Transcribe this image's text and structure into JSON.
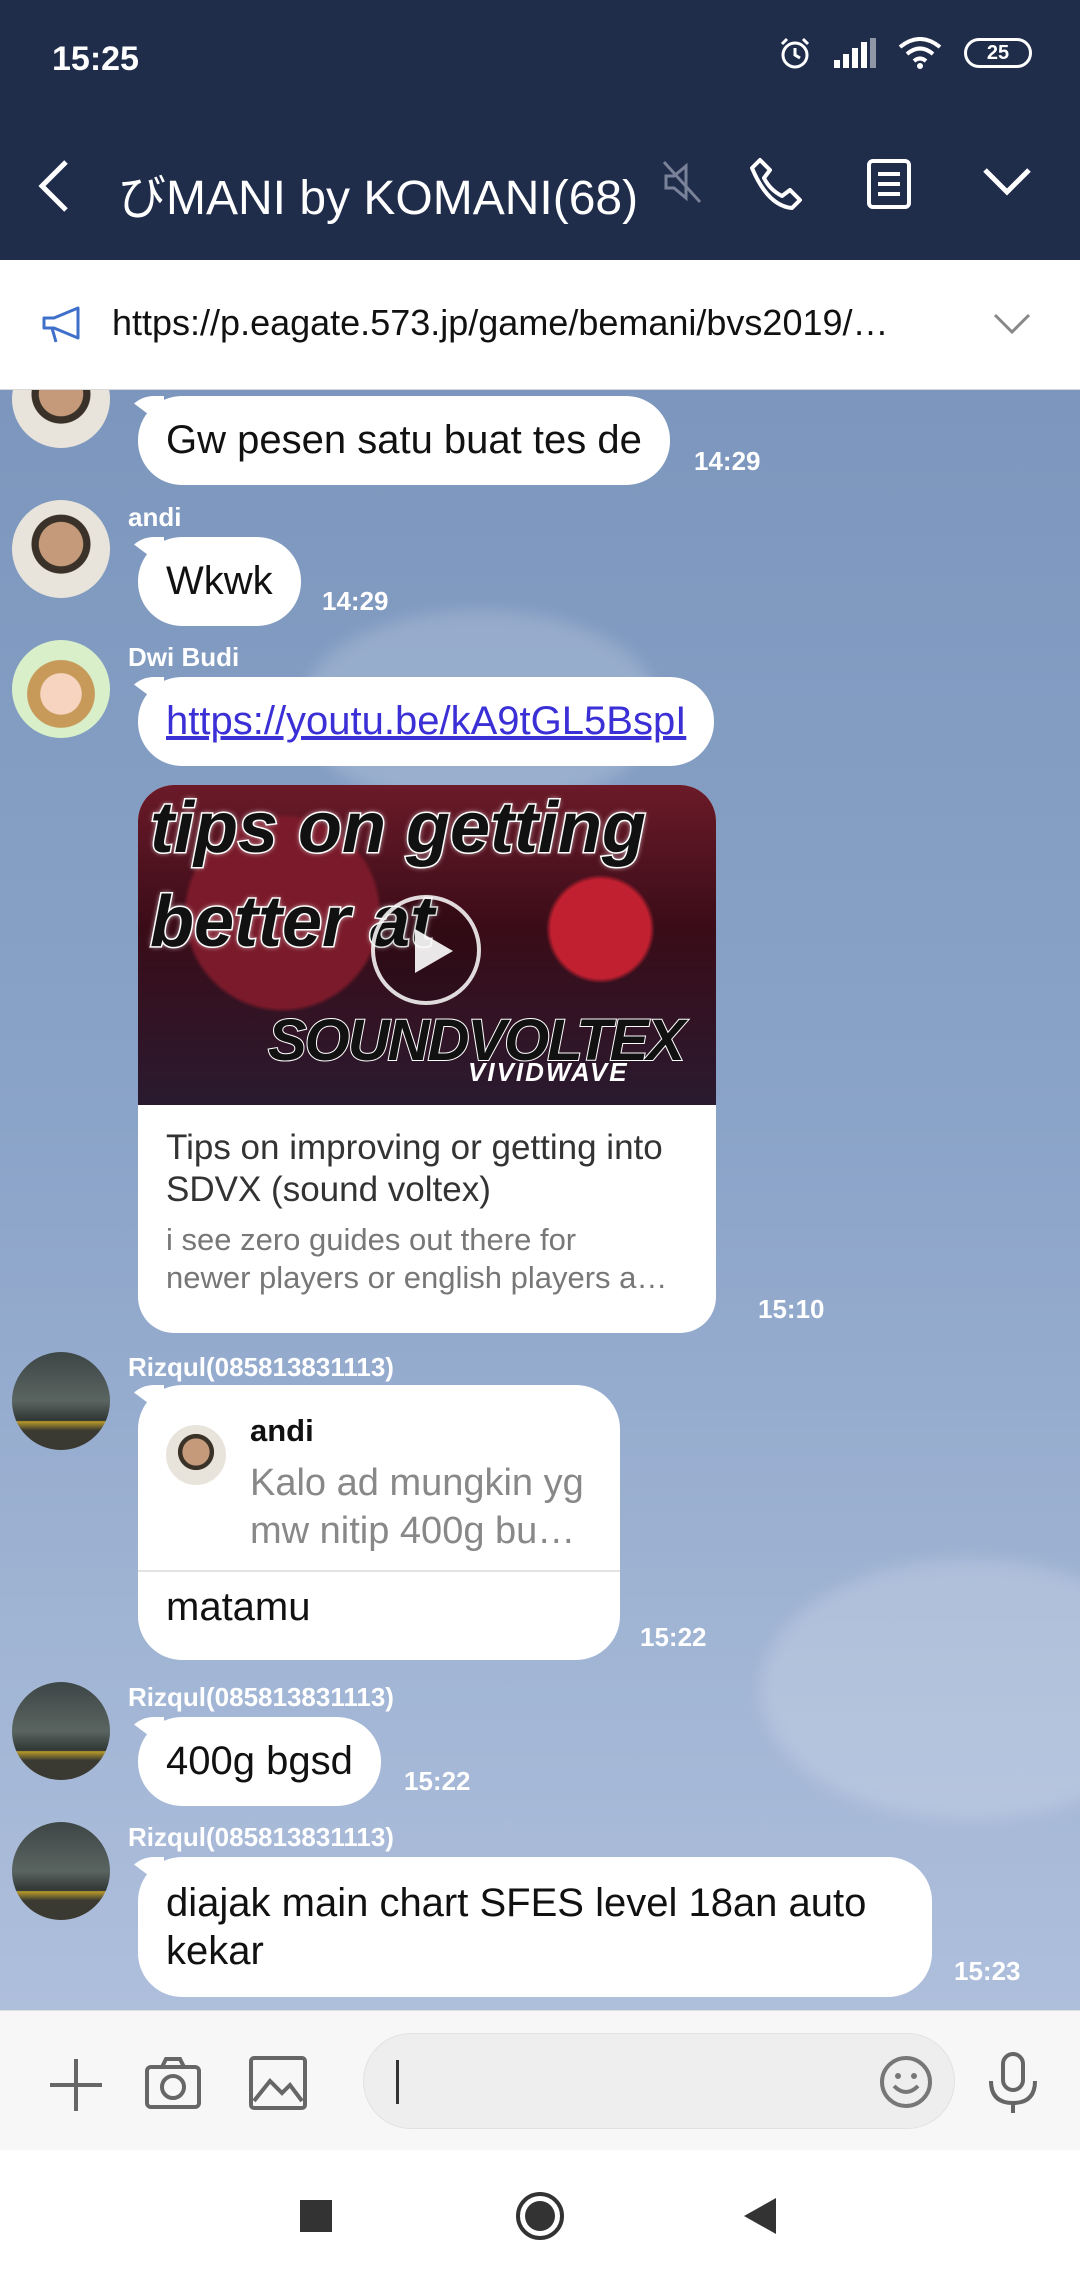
{
  "status_bar": {
    "time": "15:25",
    "battery": "25"
  },
  "header": {
    "title": "びMANI by KOMANI(68)"
  },
  "announcement": {
    "text": "https://p.eagate.573.jp/game/bemani/bvs2019/…"
  },
  "messages": [
    {
      "text": "Gw pesen satu buat tes de",
      "time": "14:29"
    },
    {
      "sender": "andi",
      "text": "Wkwk",
      "time": "14:29"
    },
    {
      "sender": "Dwi Budi",
      "link": "https://youtu.be/kA9tGL5BspI"
    },
    {
      "thumbnail_line1": "tips on getting",
      "thumbnail_line2": "better at",
      "thumbnail_logo": "SOUNDVOLTEX",
      "thumbnail_sub": "VIVIDWAVE",
      "title": "Tips on improving or getting into SDVX (sound voltex)",
      "desc_line1": "i see zero guides out there for",
      "desc_line2": "newer players or english players a…",
      "time": "15:10"
    },
    {
      "sender": "Rizqul(085813831113)",
      "quote_name": "andi",
      "quote_line1": "Kalo ad mungkin yg",
      "quote_line2": "mw nitip 400g bu…",
      "text": "matamu",
      "time": "15:22"
    },
    {
      "sender": "Rizqul(085813831113)",
      "text": "400g bgsd",
      "time": "15:22"
    },
    {
      "sender": "Rizqul(085813831113)",
      "text_line1": "diajak main chart SFES level 18an auto",
      "text_line2": "kekar",
      "time": "15:23"
    }
  ],
  "colors": {
    "header_bg": "#1f2c4a",
    "chat_bg": "#7f9ac0",
    "link": "#3b2fd6"
  },
  "icons": [
    "back-icon",
    "mute-icon",
    "phone-icon",
    "notes-icon",
    "chevron-down-icon",
    "megaphone-icon",
    "plus-icon",
    "camera-icon",
    "image-icon",
    "emoji-icon",
    "microphone-icon"
  ]
}
